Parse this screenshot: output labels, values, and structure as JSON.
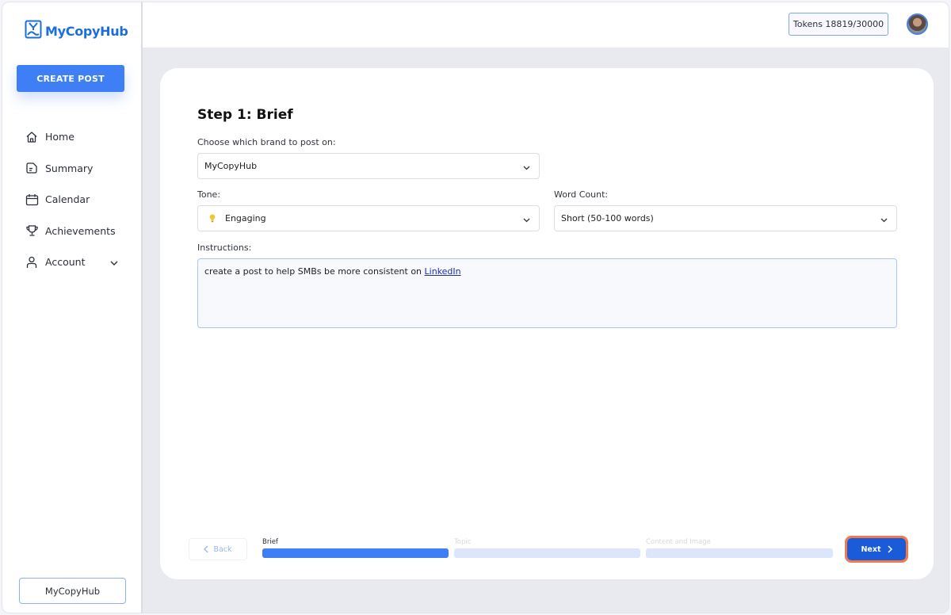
{
  "app": {
    "brand_name": "MyCopyHub",
    "accent_color": "#3f7ff5"
  },
  "sidebar": {
    "create_post_label": "CREATE POST",
    "items": [
      {
        "label": "Home",
        "icon": "home-icon"
      },
      {
        "label": "Summary",
        "icon": "document-icon"
      },
      {
        "label": "Calendar",
        "icon": "calendar-icon"
      },
      {
        "label": "Achievements",
        "icon": "trophy-icon"
      },
      {
        "label": "Account",
        "icon": "user-icon",
        "expandable": true
      }
    ],
    "brand_switcher_label": "MyCopyHub"
  },
  "header": {
    "tokens_label": "Tokens 18819/30000",
    "avatar": "user-avatar"
  },
  "form": {
    "title": "Step 1: Brief",
    "brand_label": "Choose which brand to post on:",
    "brand_value": "MyCopyHub",
    "tone_label": "Tone:",
    "tone_value": "Engaging",
    "tone_icon": "lightbulb-icon",
    "word_count_label": "Word Count:",
    "word_count_value": "Short (50-100 words)",
    "instructions_label": "Instructions:",
    "instructions_text": "create a post to help SMBs be more consistent on ",
    "instructions_link": "LinkedIn"
  },
  "stepper": {
    "back_label": "Back",
    "next_label": "Next",
    "steps": [
      {
        "label": "Brief",
        "status": "active",
        "progress": 1.0
      },
      {
        "label": "Topic",
        "status": "pending",
        "progress": 0
      },
      {
        "label": "Content and Image",
        "status": "pending",
        "progress": 0
      }
    ],
    "active_color": "#3f7ff5",
    "inactive_color": "#dbe5fb",
    "highlight_color": "#f27a4a"
  }
}
